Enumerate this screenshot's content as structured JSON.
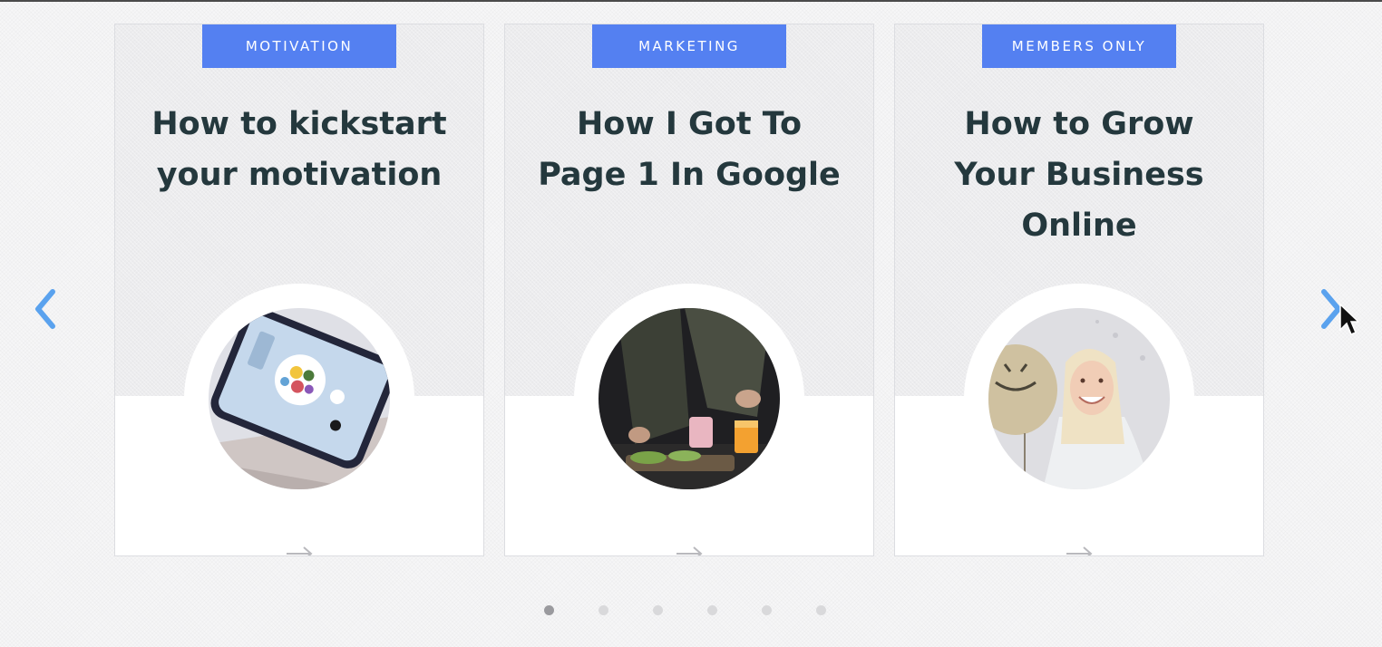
{
  "carousel": {
    "prev_icon": "chevron-left-icon",
    "next_icon": "chevron-right-icon",
    "accent_color": "#5480f1",
    "arrow_color": "#5aa2ee",
    "cards": [
      {
        "tag": "MOTIVATION",
        "title": "How to kickstart your motivation",
        "image": "phone-on-box-photo",
        "link_icon": "arrow-right-icon"
      },
      {
        "tag": "MARKETING",
        "title": "How I Got To Page 1 In Google",
        "image": "cooking-breakfast-photo",
        "link_icon": "arrow-right-icon"
      },
      {
        "tag": "MEMBERS ONLY",
        "title": "How to Grow Your Business Online",
        "image": "smiling-woman-with-balloon-photo",
        "link_icon": "arrow-right-icon"
      }
    ],
    "pagination": {
      "total": 6,
      "active_index": 0
    }
  }
}
